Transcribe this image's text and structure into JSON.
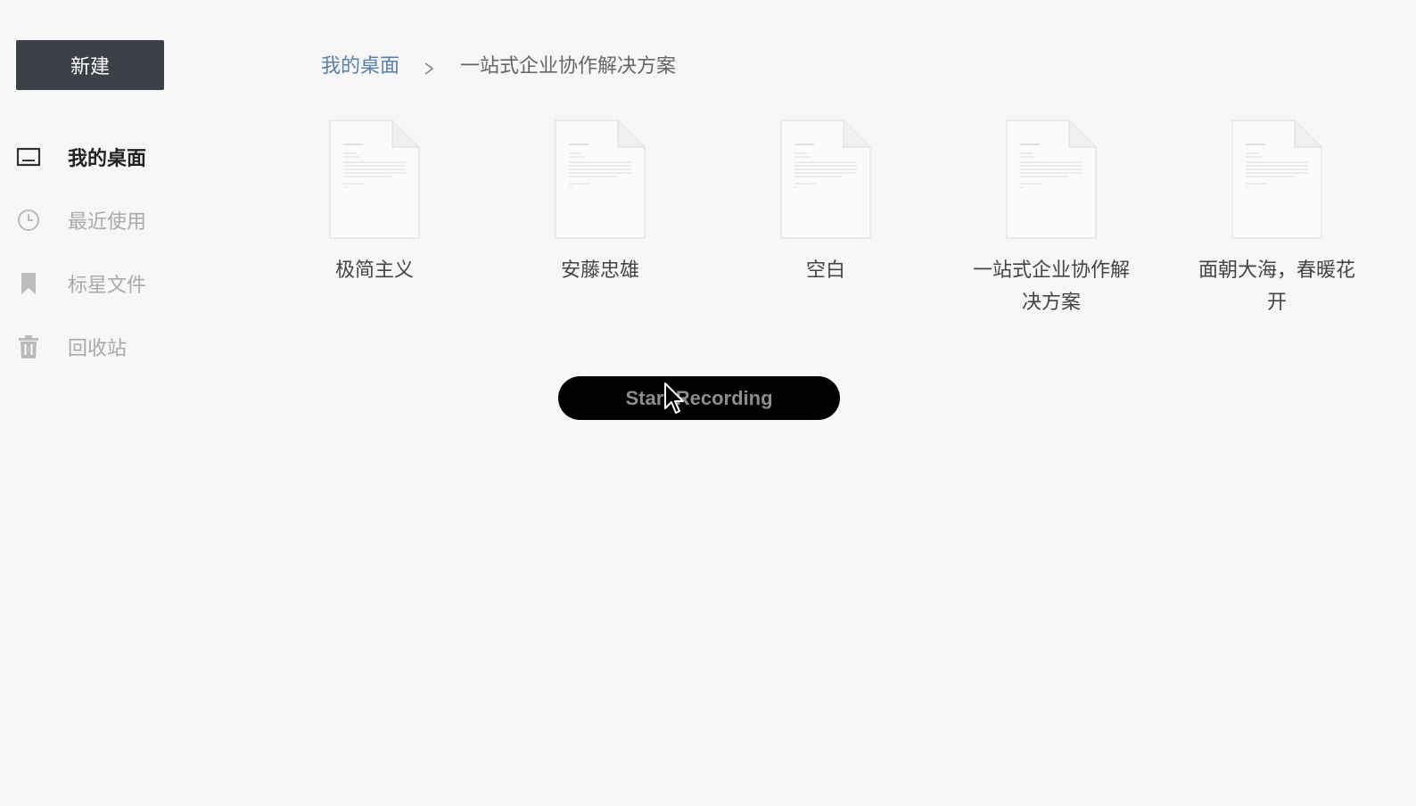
{
  "sidebar": {
    "new_button_label": "新建",
    "items": [
      {
        "label": "我的桌面",
        "icon": "desktop-icon",
        "active": true
      },
      {
        "label": "最近使用",
        "icon": "clock-icon",
        "active": false
      },
      {
        "label": "标星文件",
        "icon": "bookmark-icon",
        "active": false
      },
      {
        "label": "回收站",
        "icon": "trash-icon",
        "active": false
      }
    ]
  },
  "breadcrumb": {
    "root": "我的桌面",
    "separator_icon": "chevron-right-icon",
    "current": "一站式企业协作解决方案"
  },
  "files": [
    {
      "name": "极简主义",
      "icon": "document-icon"
    },
    {
      "name": "安藤忠雄",
      "icon": "document-icon"
    },
    {
      "name": "空白",
      "icon": "document-icon"
    },
    {
      "name": "一站式企业协作解决方案",
      "icon": "document-icon"
    },
    {
      "name": "面朝大海，春暖花开",
      "icon": "document-icon"
    }
  ],
  "overlay": {
    "record_button_label": "Start Recording",
    "cursor_icon": "mouse-pointer-icon"
  },
  "colors": {
    "background": "#f7f7f7",
    "new_button_bg": "#3c4047",
    "breadcrumb_link": "#5a7fa8",
    "active_nav_text": "#222222",
    "inactive_nav_text": "#aaaaaa",
    "record_button_bg": "#000000"
  }
}
